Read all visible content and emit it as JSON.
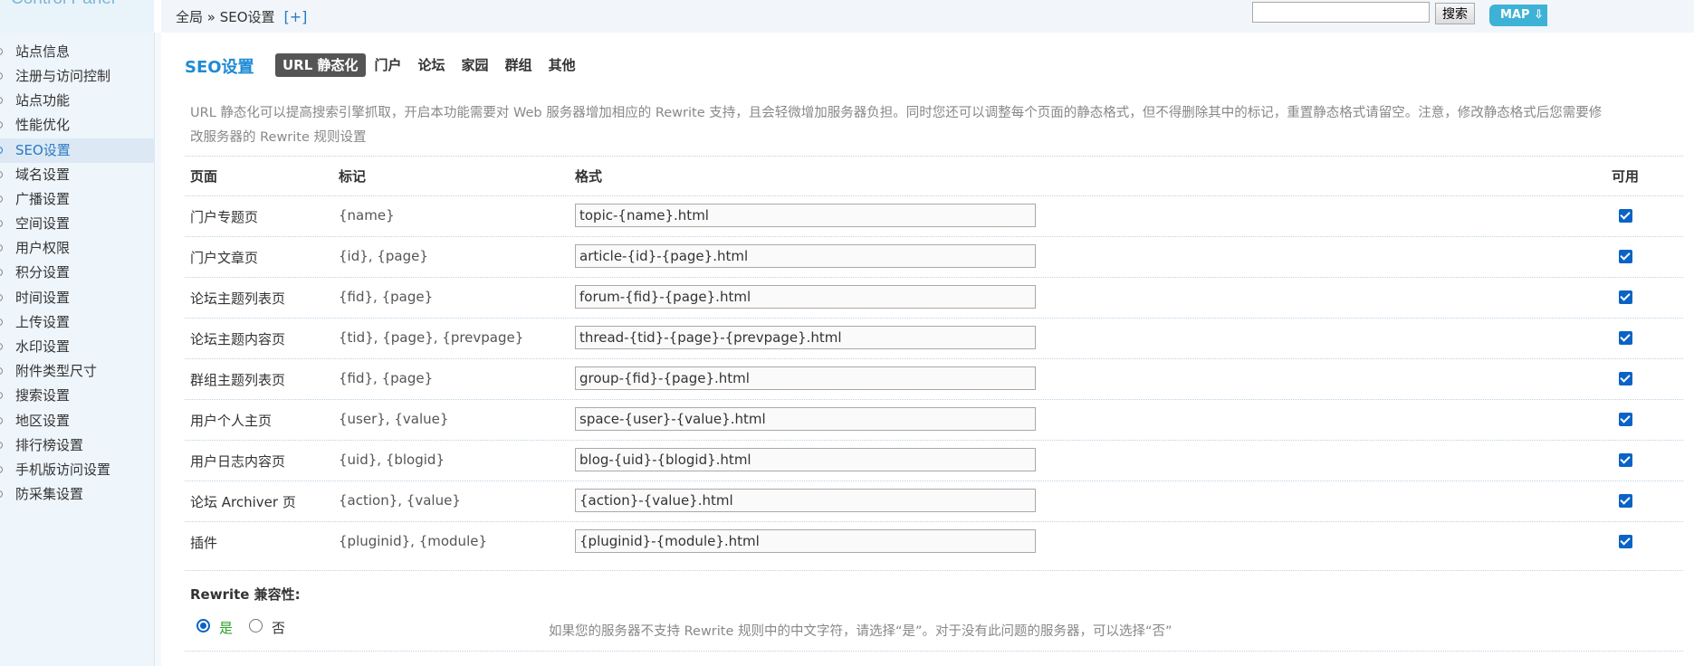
{
  "header": {
    "logo_text": "Control Panel",
    "breadcrumb": "全局 » SEO设置",
    "add_link": "[+]",
    "search_placeholder": "",
    "search_button": "搜索",
    "map_button": "MAP ⇩"
  },
  "sidebar": {
    "items": [
      {
        "label": "站点信息"
      },
      {
        "label": "注册与访问控制"
      },
      {
        "label": "站点功能"
      },
      {
        "label": "性能优化"
      },
      {
        "label": "SEO设置"
      },
      {
        "label": "域名设置"
      },
      {
        "label": "广播设置"
      },
      {
        "label": "空间设置"
      },
      {
        "label": "用户权限"
      },
      {
        "label": "积分设置"
      },
      {
        "label": "时间设置"
      },
      {
        "label": "上传设置"
      },
      {
        "label": "水印设置"
      },
      {
        "label": "附件类型尺寸"
      },
      {
        "label": "搜索设置"
      },
      {
        "label": "地区设置"
      },
      {
        "label": "排行榜设置"
      },
      {
        "label": "手机版访问设置"
      },
      {
        "label": "防采集设置"
      }
    ],
    "active": "SEO设置"
  },
  "main": {
    "title": "SEO设置",
    "tabs": [
      {
        "label": "URL 静态化"
      },
      {
        "label": "门户"
      },
      {
        "label": "论坛"
      },
      {
        "label": "家园"
      },
      {
        "label": "群组"
      },
      {
        "label": "其他"
      }
    ],
    "active_tab": "URL 静态化",
    "description": "URL 静态化可以提高搜索引擎抓取，开启本功能需要对 Web 服务器增加相应的 Rewrite 支持，且会轻微增加服务器负担。同时您还可以调整每个页面的静态格式，但不得删除其中的标记，重置静态格式请留空。注意，修改静态格式后您需要修改服务器的 Rewrite 规则设置",
    "table": {
      "headers": {
        "page": "页面",
        "mark": "标记",
        "format": "格式",
        "enabled": "可用"
      },
      "rows": [
        {
          "page": "门户专题页",
          "mark": "{name}",
          "format": "topic-{name}.html",
          "enabled": true
        },
        {
          "page": "门户文章页",
          "mark": "{id}, {page}",
          "format": "article-{id}-{page}.html",
          "enabled": true
        },
        {
          "page": "论坛主题列表页",
          "mark": "{fid}, {page}",
          "format": "forum-{fid}-{page}.html",
          "enabled": true
        },
        {
          "page": "论坛主题内容页",
          "mark": "{tid}, {page}, {prevpage}",
          "format": "thread-{tid}-{page}-{prevpage}.html",
          "enabled": true
        },
        {
          "page": "群组主题列表页",
          "mark": "{fid}, {page}",
          "format": "group-{fid}-{page}.html",
          "enabled": true
        },
        {
          "page": "用户个人主页",
          "mark": "{user}, {value}",
          "format": "space-{user}-{value}.html",
          "enabled": true
        },
        {
          "page": "用户日志内容页",
          "mark": "{uid}, {blogid}",
          "format": "blog-{uid}-{blogid}.html",
          "enabled": true
        },
        {
          "page": "论坛 Archiver 页",
          "mark": "{action}, {value}",
          "format": "{action}-{value}.html",
          "enabled": true
        },
        {
          "page": "插件",
          "mark": "{pluginid}, {module}",
          "format": "{pluginid}-{module}.html",
          "enabled": true
        }
      ]
    },
    "compat": {
      "title": "Rewrite 兼容性:",
      "yes_label": "是",
      "no_label": "否",
      "selected": "是",
      "hint": "如果您的服务器不支持 Rewrite 规则中的中文字符，请选择“是”。对于没有此问题的服务器，可以选择“否”"
    }
  },
  "colors": {
    "accent": "#1f8bd4",
    "checkbox": "#0b63c5",
    "tab_active_bg": "#555555",
    "yes_label": "#2aa02a"
  }
}
